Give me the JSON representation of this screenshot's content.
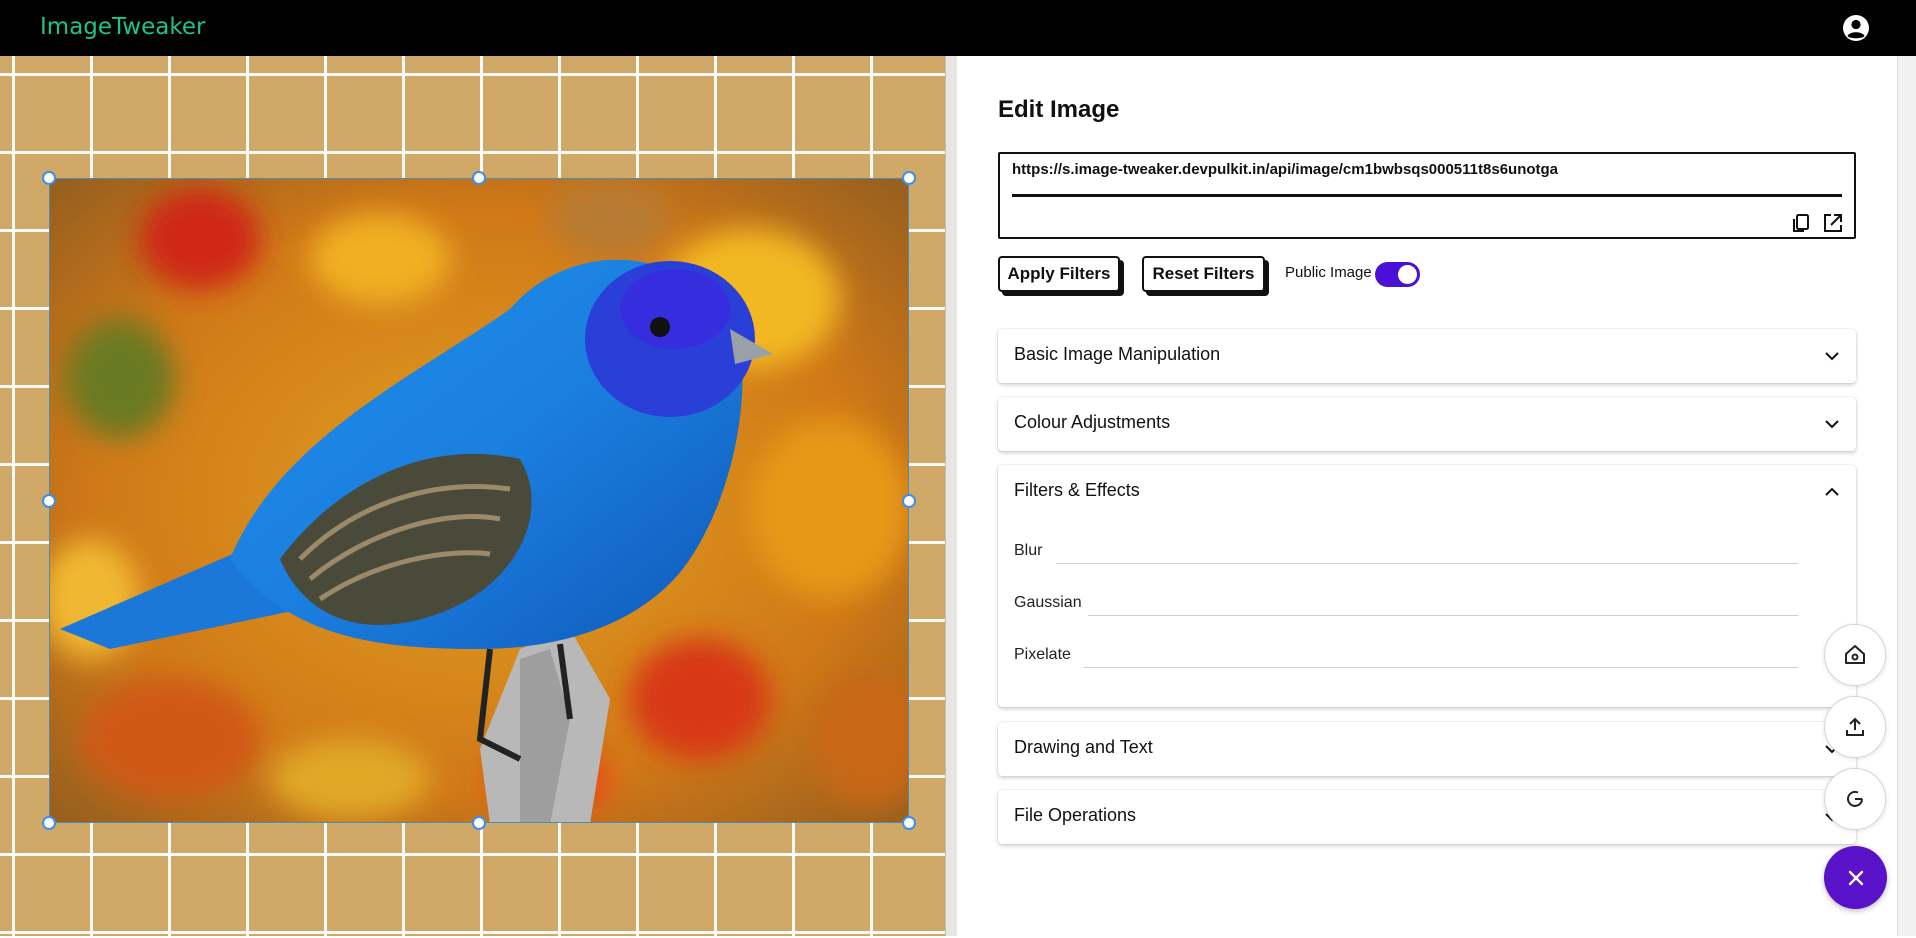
{
  "app": {
    "title": "ImageTweaker"
  },
  "editor": {
    "heading": "Edit Image",
    "url": "https://s.image-tweaker.devpulkit.in/api/image/cm1bwbsqs000511t8s6unotga",
    "apply_label": "Apply Filters",
    "reset_label": "Reset Filters",
    "public_label": "Public Image",
    "public_enabled": true
  },
  "sections": [
    {
      "title": "Basic Image Manipulation",
      "expanded": false
    },
    {
      "title": "Colour Adjustments",
      "expanded": false
    },
    {
      "title": "Filters & Effects",
      "expanded": true,
      "controls": [
        {
          "label": "Blur"
        },
        {
          "label": "Gaussian"
        },
        {
          "label": "Pixelate"
        }
      ]
    },
    {
      "title": "Drawing and Text",
      "expanded": false
    },
    {
      "title": "File Operations",
      "expanded": false
    }
  ],
  "icons": {
    "account": "account-circle-icon",
    "copy": "copy-icon",
    "open": "open-external-icon",
    "home": "home-icon",
    "upload": "upload-icon",
    "reset": "rotate-icon",
    "close": "close-icon"
  },
  "colors": {
    "brand": "#1ec38a",
    "accent": "#5a12c8",
    "toggle": "#4a10d8",
    "canvas_bg": "#d0a868"
  }
}
